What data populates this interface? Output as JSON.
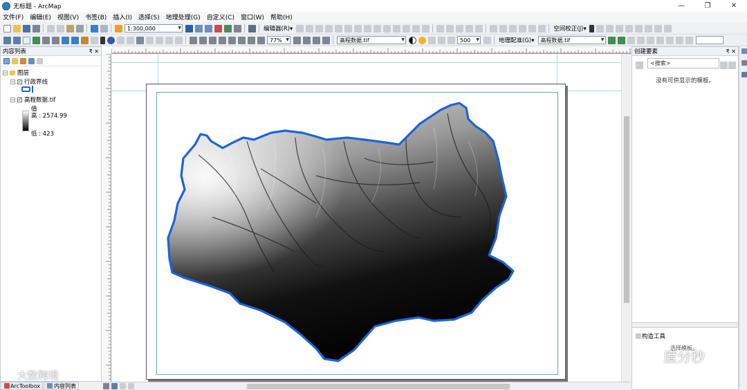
{
  "window": {
    "title": "无标题 - ArcMap",
    "min": "—",
    "max": "❐",
    "close": "✕"
  },
  "menu": [
    "文件(F)",
    "编辑(E)",
    "视图(V)",
    "书签(B)",
    "插入(I)",
    "选择(S)",
    "地理处理(G)",
    "自定义(C)",
    "窗口(W)",
    "帮助(H)"
  ],
  "toolbar1": {
    "scale": "1:300,000",
    "editor": "编辑器(R)▾",
    "spatial_adjust": "空间校正(J)▾"
  },
  "toolbar2": {
    "zoom": "77%",
    "layer": "高程数据.tif",
    "sample": "500",
    "georef": "地理配准(G)▾",
    "georef_layer": "高程数据.tif"
  },
  "toc": {
    "title": "内容列表",
    "layers_root": "图层",
    "layer1": "行政界线",
    "layer2": "高程数据.tif",
    "legend_value": "值",
    "legend_high": "高 : 2574.99",
    "legend_low": "低 : 423",
    "tab_arctoolbox": "ArcToolbox",
    "tab_toc": "内容列表"
  },
  "create_features": {
    "title": "创建要素",
    "search_placeholder": "<搜索>",
    "empty_msg": "没有可供显示的模板。",
    "construct_tools": "构造工具",
    "select_template": "选择模板。"
  },
  "watermark": {
    "left": "大数跨境",
    "right": "度分秒"
  },
  "colors": {
    "boundary": "#1d63d8",
    "legend_high": "#ffffff",
    "legend_low": "#000000"
  }
}
